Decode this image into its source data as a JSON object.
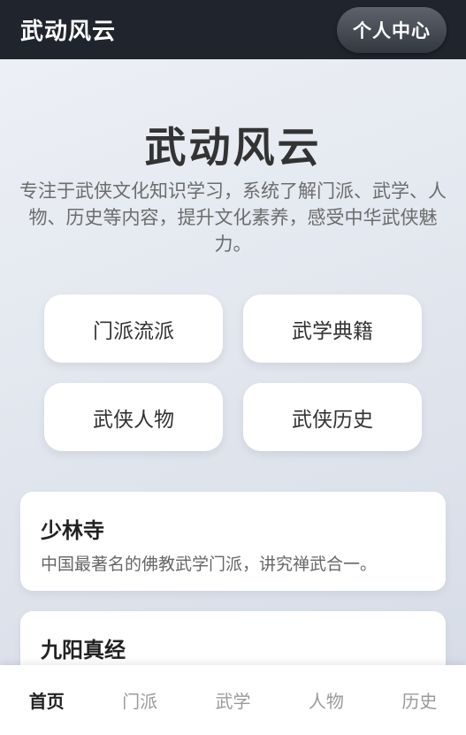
{
  "header": {
    "app_title": "武动风云",
    "profile_button": "个人中心"
  },
  "hero": {
    "title": "武动风云",
    "description": "专注于武侠文化知识学习，系统了解门派、武学、人物、历史等内容，提升文化素养，感受中华武侠魅力。"
  },
  "categories": [
    {
      "label": "门派流派"
    },
    {
      "label": "武学典籍"
    },
    {
      "label": "武侠人物"
    },
    {
      "label": "武侠历史"
    }
  ],
  "cards": [
    {
      "title": "少林寺",
      "description": "中国最著名的佛教武学门派，讲究禅武合一。"
    },
    {
      "title": "九阳真经",
      "description": ""
    }
  ],
  "bottom_nav": {
    "items": [
      {
        "label": "首页",
        "active": true
      },
      {
        "label": "门派",
        "active": false
      },
      {
        "label": "武学",
        "active": false
      },
      {
        "label": "人物",
        "active": false
      },
      {
        "label": "历史",
        "active": false
      }
    ]
  }
}
